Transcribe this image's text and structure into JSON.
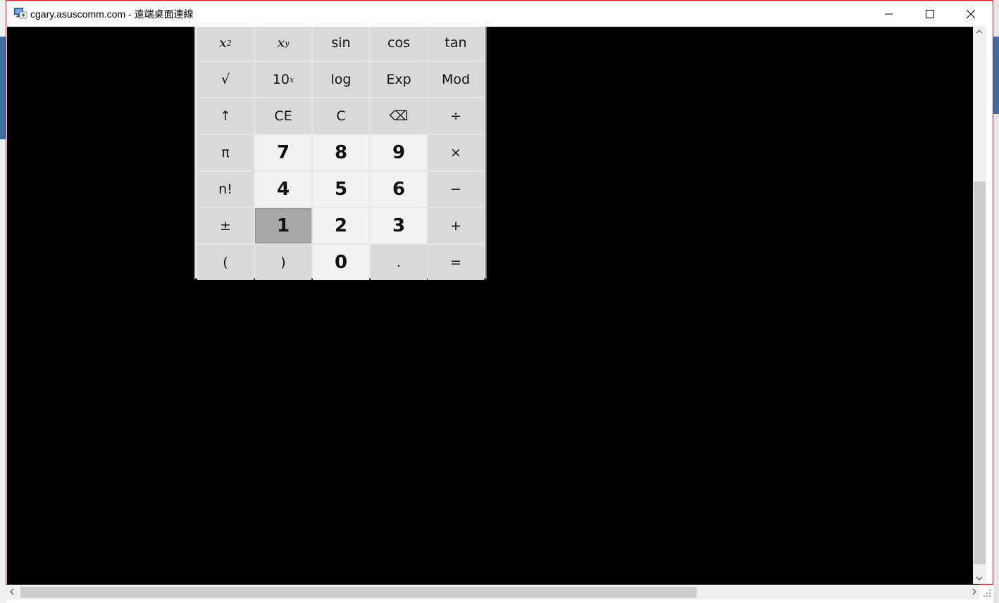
{
  "window": {
    "title": "cgary.asuscomm.com - 遠端桌面連線",
    "minimize_icon": "minimize-icon",
    "maximize_icon": "maximize-icon",
    "close_icon": "close-icon"
  },
  "calculator": {
    "rows": [
      [
        {
          "name": "square-button",
          "label": "x",
          "sup": "2",
          "style": "italic"
        },
        {
          "name": "power-button",
          "label": "x",
          "sup": "y",
          "style": "italic"
        },
        {
          "name": "sin-button",
          "label": "sin"
        },
        {
          "name": "cos-button",
          "label": "cos"
        },
        {
          "name": "tan-button",
          "label": "tan"
        }
      ],
      [
        {
          "name": "sqrt-button",
          "label": "√"
        },
        {
          "name": "ten-power-button",
          "label": "10",
          "sup": "x"
        },
        {
          "name": "log-button",
          "label": "log"
        },
        {
          "name": "exp-button",
          "label": "Exp"
        },
        {
          "name": "mod-button",
          "label": "Mod"
        }
      ],
      [
        {
          "name": "shift-button",
          "label": "↑"
        },
        {
          "name": "clear-entry-button",
          "label": "CE"
        },
        {
          "name": "clear-button",
          "label": "C"
        },
        {
          "name": "backspace-button",
          "label": "⌫"
        },
        {
          "name": "divide-button",
          "label": "÷"
        }
      ],
      [
        {
          "name": "pi-button",
          "label": "π"
        },
        {
          "name": "digit-7-button",
          "label": "7",
          "num": true
        },
        {
          "name": "digit-8-button",
          "label": "8",
          "num": true
        },
        {
          "name": "digit-9-button",
          "label": "9",
          "num": true
        },
        {
          "name": "multiply-button",
          "label": "×"
        }
      ],
      [
        {
          "name": "factorial-button",
          "label": "n!"
        },
        {
          "name": "digit-4-button",
          "label": "4",
          "num": true
        },
        {
          "name": "digit-5-button",
          "label": "5",
          "num": true
        },
        {
          "name": "digit-6-button",
          "label": "6",
          "num": true
        },
        {
          "name": "subtract-button",
          "label": "−"
        }
      ],
      [
        {
          "name": "negate-button",
          "label": "±"
        },
        {
          "name": "digit-1-button",
          "label": "1",
          "num": true,
          "pressed": true
        },
        {
          "name": "digit-2-button",
          "label": "2",
          "num": true
        },
        {
          "name": "digit-3-button",
          "label": "3",
          "num": true
        },
        {
          "name": "add-button",
          "label": "+"
        }
      ],
      [
        {
          "name": "open-paren-button",
          "label": "("
        },
        {
          "name": "close-paren-button",
          "label": ")"
        },
        {
          "name": "digit-0-button",
          "label": "0",
          "num": true
        },
        {
          "name": "decimal-button",
          "label": "."
        },
        {
          "name": "equals-button",
          "label": "="
        }
      ]
    ]
  },
  "colors": {
    "window_border": "#e81123",
    "remote_background": "#000000",
    "key_function": "#d9d9d9",
    "key_number": "#f2f2f2",
    "key_pressed": "#a8a8a8"
  }
}
